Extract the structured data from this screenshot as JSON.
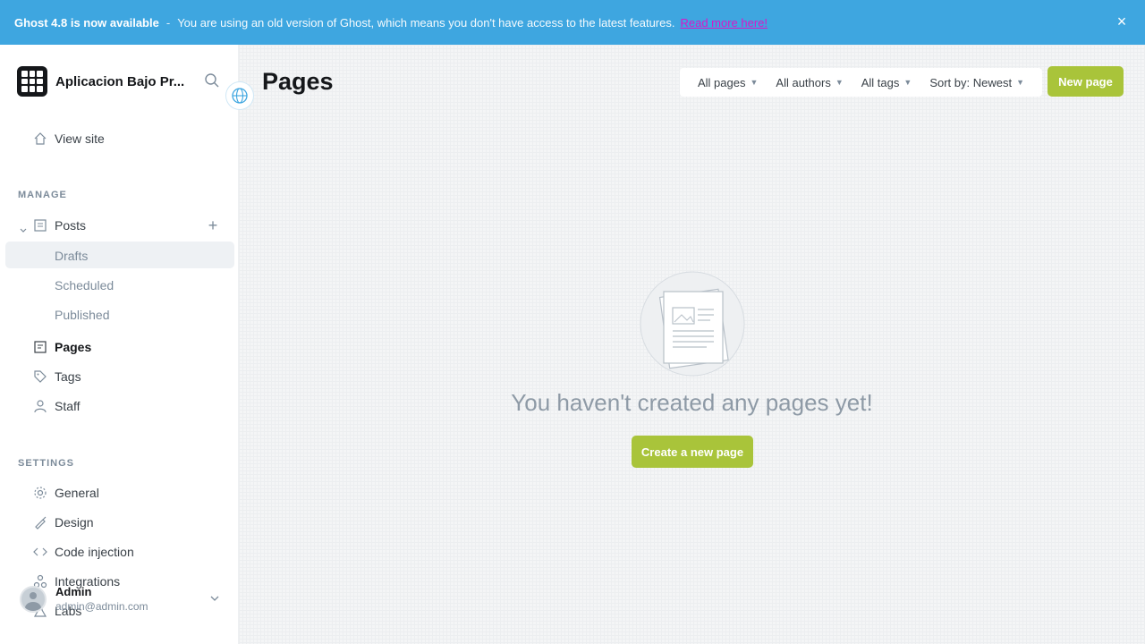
{
  "banner": {
    "title": "Ghost 4.8 is now available",
    "separator": "-",
    "message": "You are using an old version of Ghost, which means you don't have access to the latest features.",
    "link": "Read more here!",
    "close_icon": "close-icon",
    "color": "#3ea6e0"
  },
  "sidebar": {
    "site_name": "Aplicacion Bajo Pr...",
    "view_site": "View site",
    "manage_title": "MANAGE",
    "settings_title": "SETTINGS",
    "posts": "Posts",
    "posts_sub": [
      "Drafts",
      "Scheduled",
      "Published"
    ],
    "pages": "Pages",
    "tags": "Tags",
    "staff": "Staff",
    "settings_items": [
      "General",
      "Design",
      "Code injection",
      "Integrations",
      "Labs"
    ]
  },
  "user": {
    "name": "Admin",
    "email": "admin@admin.com"
  },
  "main": {
    "title": "Pages",
    "filters": [
      "All pages",
      "All authors",
      "All tags",
      "Sort by: Newest"
    ],
    "new_page": "New page",
    "empty_text": "You haven't created any pages yet!",
    "create_button": "Create a new page"
  },
  "colors": {
    "accent_green": "#a9c43a",
    "banner_blue": "#3ea6e0",
    "link_magenta": "#d818c8"
  }
}
